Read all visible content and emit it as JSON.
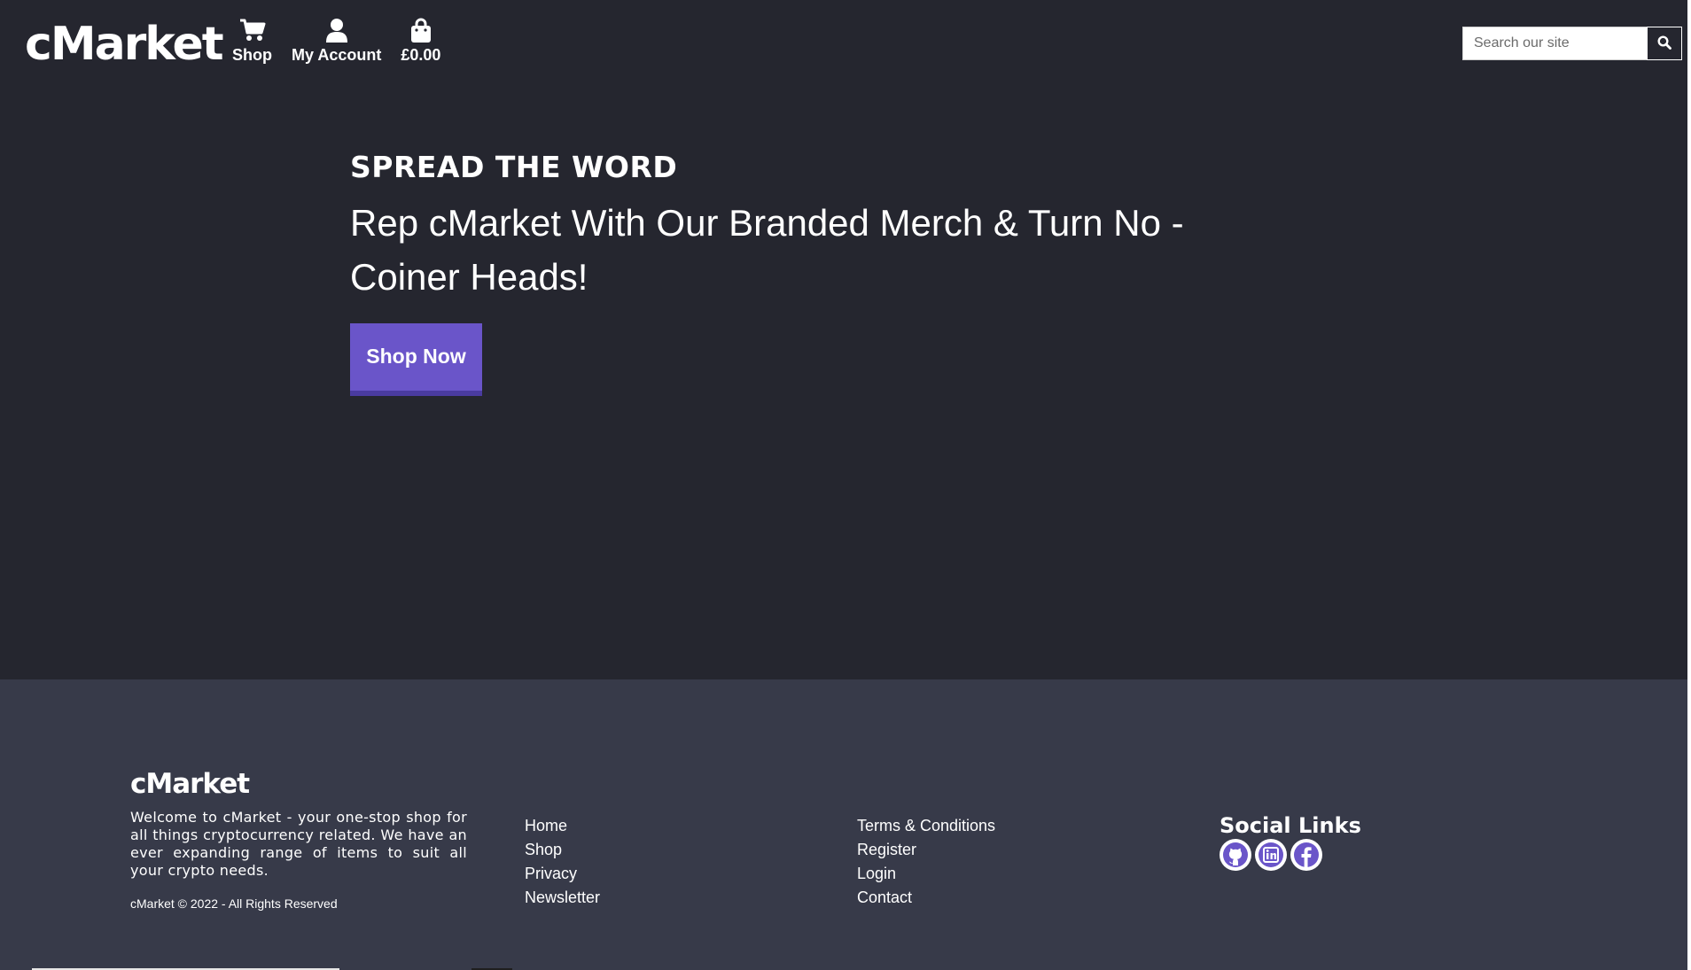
{
  "header": {
    "logo": "cMarket",
    "nav": [
      {
        "label": "Shop",
        "icon": "cart-icon"
      },
      {
        "label": "My Account",
        "icon": "user-icon"
      },
      {
        "label": "£0.00",
        "icon": "bag-icon"
      }
    ],
    "search": {
      "placeholder": "Search our site",
      "value": "",
      "button_icon": "search-icon"
    }
  },
  "hero": {
    "eyebrow": "SPREAD THE WORD",
    "heading": "Rep cMarket With Our Branded Merch & Turn No - Coiner Heads!",
    "button_label": "Shop Now"
  },
  "footer": {
    "logo": "cMarket",
    "about": "Welcome to cMarket - your one-stop shop for all things cryptocurrency related. We have an ever expanding range of items to suit all your crypto needs.",
    "copyright": "cMarket © 2022 - All Rights Reserved",
    "links_col_1": [
      "Home",
      "Shop",
      "Privacy",
      "Newsletter"
    ],
    "links_col_2": [
      "Terms & Conditions",
      "Register",
      "Login",
      "Contact"
    ],
    "social": {
      "title": "Social Links",
      "icons": [
        "github-icon",
        "linkedin-icon",
        "facebook-icon"
      ]
    }
  },
  "colors": {
    "page_bg": "#25262f",
    "footer_bg": "#373a49",
    "accent": "#6a55c9",
    "text": "#ffffff"
  }
}
